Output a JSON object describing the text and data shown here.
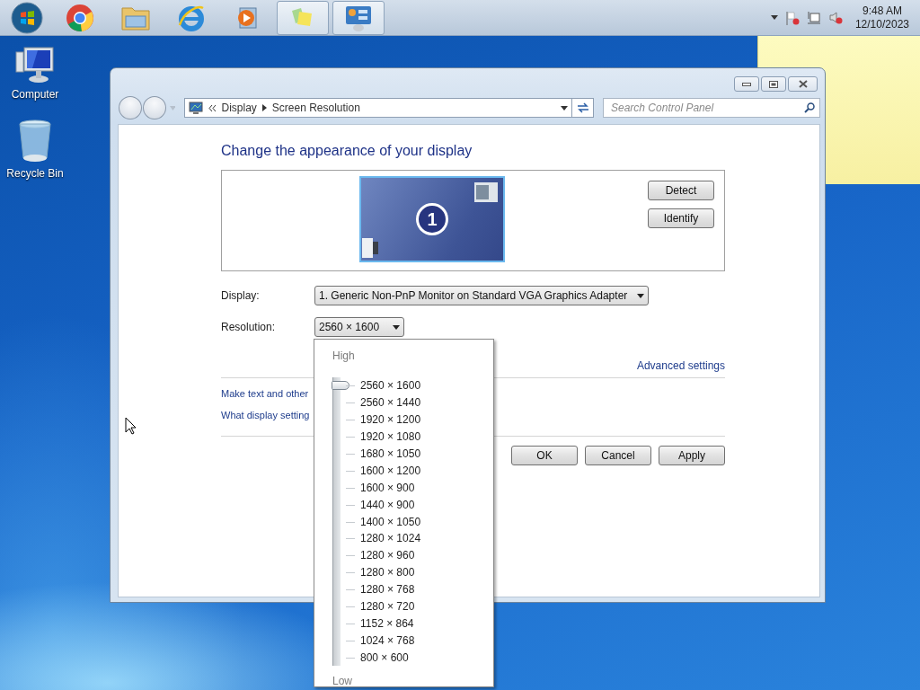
{
  "taskbar": {
    "apps": [
      {
        "kind": "start",
        "running": false
      },
      {
        "kind": "chrome",
        "running": false
      },
      {
        "kind": "folder",
        "running": false
      },
      {
        "kind": "ie",
        "running": false
      },
      {
        "kind": "media",
        "running": false
      },
      {
        "kind": "notes",
        "running": true
      },
      {
        "kind": "control_panel",
        "running": true
      }
    ],
    "clock": {
      "time": "9:48 AM",
      "date": "12/10/2023"
    }
  },
  "desktop_icons": [
    {
      "kind": "computer",
      "label": "Computer"
    },
    {
      "kind": "recycle_bin",
      "label": "Recycle Bin"
    }
  ],
  "window": {
    "breadcrumbs": [
      "Display",
      "Screen Resolution"
    ],
    "search": {
      "placeholder": "Search Control Panel"
    },
    "heading": "Change the appearance of your display",
    "monitor": {
      "number": "1",
      "selected": true
    },
    "side_buttons": [
      "Detect",
      "Identify"
    ],
    "fields": [
      {
        "label": "Display:",
        "value": "1. Generic Non-PnP Monitor on Standard VGA Graphics Adapter"
      },
      {
        "label": "Resolution:",
        "value": "2560 × 1600"
      }
    ],
    "advanced_link": "Advanced settings",
    "links": [
      "Make text and other",
      "What display setting"
    ],
    "buttons": [
      "OK",
      "Cancel",
      "Apply"
    ]
  },
  "resolution_menu": {
    "high_label": "High",
    "low_label": "Low",
    "level": 1,
    "options": [
      "2560 × 1600",
      "2560 × 1440",
      "1920 × 1200",
      "1920 × 1080",
      "1680 × 1050",
      "1600 × 1200",
      "1600 × 900",
      "1440 × 900",
      "1400 × 1050",
      "1280 × 1024",
      "1280 × 960",
      "1280 × 800",
      "1280 × 768",
      "1280 × 720",
      "1152 × 864",
      "1024 × 768",
      "800 × 600"
    ]
  }
}
